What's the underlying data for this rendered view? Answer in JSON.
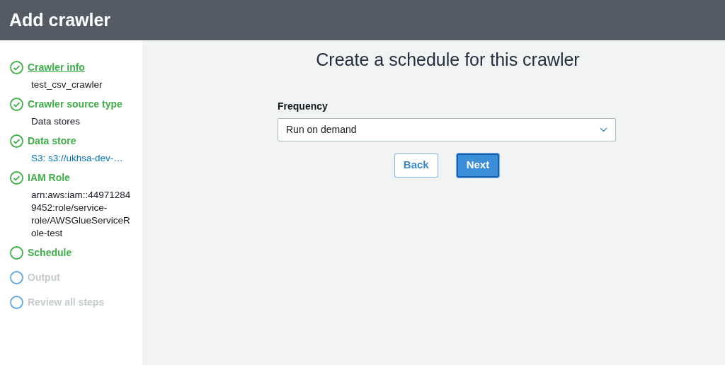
{
  "header": {
    "title": "Add crawler"
  },
  "steps": [
    {
      "label": "Crawler info",
      "completed": true,
      "disabled": false,
      "selected": true,
      "detail": {
        "kind": "text",
        "text": "test_csv_crawler"
      }
    },
    {
      "label": "Crawler source type",
      "completed": true,
      "disabled": false,
      "selected": false,
      "detail": {
        "kind": "text",
        "text": "Data stores"
      }
    },
    {
      "label": "Data store",
      "completed": true,
      "disabled": false,
      "selected": false,
      "detail": {
        "kind": "link",
        "text": "S3: s3://ukhsa-dev-…"
      }
    },
    {
      "label": "IAM Role",
      "completed": true,
      "disabled": false,
      "selected": false,
      "detail": {
        "kind": "text",
        "text": "arn:aws:iam::449712849452:role/service-role/AWSGlueServiceRole-test"
      }
    },
    {
      "label": "Schedule",
      "completed": false,
      "disabled": false,
      "selected": false
    },
    {
      "label": "Output",
      "completed": false,
      "disabled": true,
      "selected": false
    },
    {
      "label": "Review all steps",
      "completed": false,
      "disabled": true,
      "selected": false
    }
  ],
  "main": {
    "heading": "Create a schedule for this crawler",
    "frequency": {
      "label": "Frequency",
      "value": "Run on demand"
    },
    "buttons": [
      {
        "label": "Back",
        "kind": "secondary"
      },
      {
        "label": "Next",
        "kind": "primary"
      }
    ]
  }
}
